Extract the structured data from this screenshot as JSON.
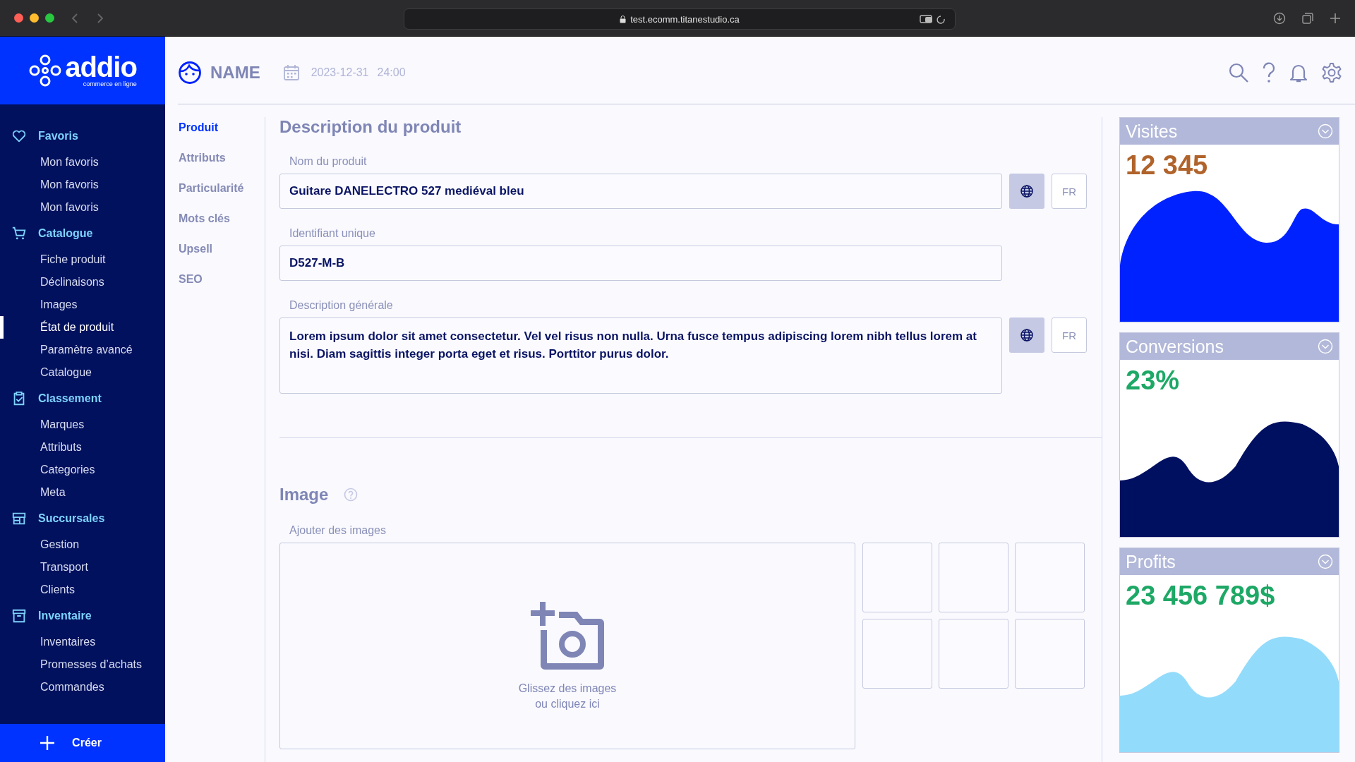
{
  "browser": {
    "url": "test.ecomm.titanestudio.ca"
  },
  "logo": {
    "name": "addio",
    "tagline": "commerce en ligne"
  },
  "sidebar": {
    "groups": [
      {
        "label": "Favoris",
        "kind": "favorites",
        "items": [
          {
            "label": "Mon favoris",
            "selected": false
          },
          {
            "label": "Mon favoris",
            "selected": false
          },
          {
            "label": "Mon favoris",
            "selected": false
          }
        ]
      },
      {
        "label": "Catalogue",
        "kind": "catalog",
        "items": [
          {
            "label": "Fiche produit",
            "selected": false
          },
          {
            "label": "Déclinaisons",
            "selected": false
          },
          {
            "label": "Images",
            "selected": false
          },
          {
            "label": "État de produit",
            "selected": true
          },
          {
            "label": "Paramètre avancé",
            "selected": false
          },
          {
            "label": "Catalogue",
            "selected": false
          }
        ]
      },
      {
        "label": "Classement",
        "kind": "ranking",
        "items": [
          {
            "label": "Marques",
            "selected": false
          },
          {
            "label": "Attributs",
            "selected": false
          },
          {
            "label": "Categories",
            "selected": false
          },
          {
            "label": "Meta",
            "selected": false
          }
        ]
      },
      {
        "label": "Succursales",
        "kind": "branches",
        "items": [
          {
            "label": "Gestion",
            "selected": false
          },
          {
            "label": "Transport",
            "selected": false
          },
          {
            "label": "Clients",
            "selected": false
          }
        ]
      },
      {
        "label": "Inventaire",
        "kind": "inventory",
        "items": [
          {
            "label": "Inventaires",
            "selected": false
          },
          {
            "label": "Promesses d’achats",
            "selected": false
          },
          {
            "label": "Commandes",
            "selected": false
          }
        ]
      }
    ],
    "create_button": "Créer"
  },
  "header": {
    "title": "NAME",
    "date": "2023-12-31",
    "time": "24:00"
  },
  "subnav": [
    {
      "label": "Produit",
      "selected": true
    },
    {
      "label": "Attributs",
      "selected": false
    },
    {
      "label": "Particularité",
      "selected": false
    },
    {
      "label": "Mots clés",
      "selected": false
    },
    {
      "label": "Upsell",
      "selected": false
    },
    {
      "label": "SEO",
      "selected": false
    }
  ],
  "form": {
    "title": "Description du produit",
    "fields": [
      {
        "kind": "text",
        "label": "Nom du produit",
        "value": "Guitare DANELECTRO 527 mediéval bleu",
        "language": "FR"
      },
      {
        "kind": "text",
        "label": "Identifiant unique",
        "value": "D527-M-B"
      },
      {
        "kind": "textarea",
        "label": "Description générale",
        "value": "Lorem ipsum dolor sit amet consectetur. Vel vel risus non nulla. Urna fusce tempus adipiscing lorem nibh tellus lorem at nisi. Diam sagittis integer porta eget et risus. Porttitor purus dolor.",
        "language": "FR"
      }
    ]
  },
  "image_section": {
    "title": "Image",
    "label": "Ajouter des images",
    "dropzone_lines": [
      "Glissez des images",
      "ou cliquez ici"
    ],
    "thumbnails": [
      {
        "kind": "empty"
      },
      {
        "kind": "empty"
      },
      {
        "kind": "empty"
      },
      {
        "kind": "empty"
      },
      {
        "kind": "empty"
      },
      {
        "kind": "empty"
      }
    ]
  },
  "stats": [
    {
      "title": "Visites",
      "value": "12 345",
      "color": "#b0632a"
    },
    {
      "title": "Conversions",
      "value": "23%",
      "color": "#1ea866"
    },
    {
      "title": "Profits",
      "value": "23 456 789$",
      "color": "#1ea866"
    }
  ]
}
